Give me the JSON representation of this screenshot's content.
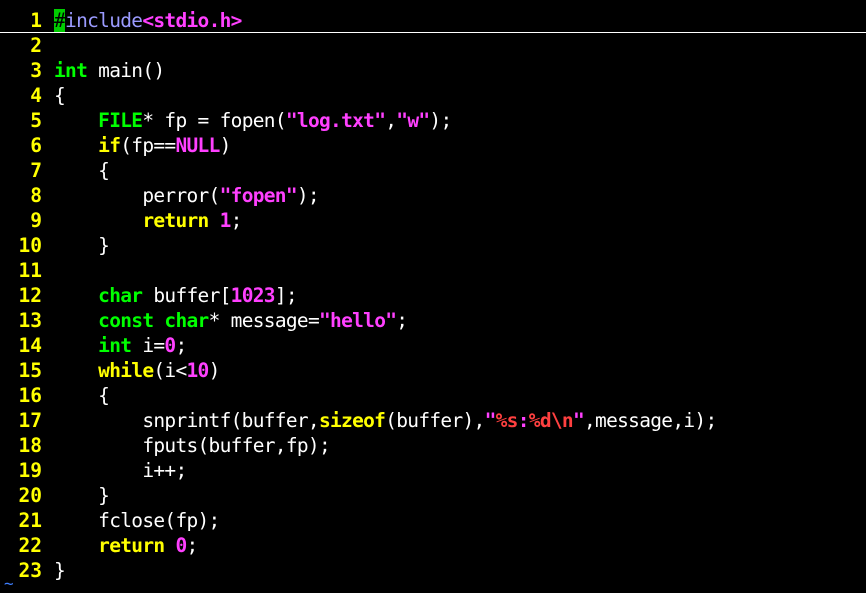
{
  "colors": {
    "background": "#000000",
    "line_number": "#ffff00",
    "keyword": "#ffff00",
    "type": "#00ff00",
    "preproc": "#9b9bff",
    "string": "#ff40ff",
    "number": "#ff40ff",
    "special": "#ff4040",
    "normal": "#ffffff",
    "cursor": "#00cc00",
    "tilde": "#3f7fff"
  },
  "editor": {
    "cursor_line": 1,
    "lines": [
      {
        "n": "1",
        "tokens": [
          {
            "t": "#",
            "c": "cursor"
          },
          {
            "t": "include",
            "c": "preproc"
          },
          {
            "t": "<stdio.h>",
            "c": "string"
          }
        ]
      },
      {
        "n": "2",
        "tokens": []
      },
      {
        "n": "3",
        "tokens": [
          {
            "t": "int",
            "c": "type"
          },
          {
            "t": " main()",
            "c": "normal"
          }
        ]
      },
      {
        "n": "4",
        "tokens": [
          {
            "t": "{",
            "c": "normal"
          }
        ]
      },
      {
        "n": "5",
        "tokens": [
          {
            "t": "    ",
            "c": "normal"
          },
          {
            "t": "FILE",
            "c": "type"
          },
          {
            "t": "* fp = fopen(",
            "c": "normal"
          },
          {
            "t": "\"log.txt\"",
            "c": "string"
          },
          {
            "t": ",",
            "c": "normal"
          },
          {
            "t": "\"w\"",
            "c": "string"
          },
          {
            "t": ");",
            "c": "normal"
          }
        ]
      },
      {
        "n": "6",
        "tokens": [
          {
            "t": "    ",
            "c": "normal"
          },
          {
            "t": "if",
            "c": "keyword"
          },
          {
            "t": "(fp==",
            "c": "normal"
          },
          {
            "t": "NULL",
            "c": "string"
          },
          {
            "t": ")",
            "c": "normal"
          }
        ]
      },
      {
        "n": "7",
        "tokens": [
          {
            "t": "    {",
            "c": "normal"
          }
        ]
      },
      {
        "n": "8",
        "tokens": [
          {
            "t": "        perror(",
            "c": "normal"
          },
          {
            "t": "\"fopen\"",
            "c": "string"
          },
          {
            "t": ");",
            "c": "normal"
          }
        ]
      },
      {
        "n": "9",
        "tokens": [
          {
            "t": "        ",
            "c": "normal"
          },
          {
            "t": "return",
            "c": "keyword"
          },
          {
            "t": " ",
            "c": "normal"
          },
          {
            "t": "1",
            "c": "number"
          },
          {
            "t": ";",
            "c": "normal"
          }
        ]
      },
      {
        "n": "10",
        "tokens": [
          {
            "t": "    }",
            "c": "normal"
          }
        ]
      },
      {
        "n": "11",
        "tokens": []
      },
      {
        "n": "12",
        "tokens": [
          {
            "t": "    ",
            "c": "normal"
          },
          {
            "t": "char",
            "c": "type"
          },
          {
            "t": " buffer[",
            "c": "normal"
          },
          {
            "t": "1023",
            "c": "number"
          },
          {
            "t": "];",
            "c": "normal"
          }
        ]
      },
      {
        "n": "13",
        "tokens": [
          {
            "t": "    ",
            "c": "normal"
          },
          {
            "t": "const",
            "c": "type"
          },
          {
            "t": " ",
            "c": "normal"
          },
          {
            "t": "char",
            "c": "type"
          },
          {
            "t": "* message=",
            "c": "normal"
          },
          {
            "t": "\"hello\"",
            "c": "string"
          },
          {
            "t": ";",
            "c": "normal"
          }
        ]
      },
      {
        "n": "14",
        "tokens": [
          {
            "t": "    ",
            "c": "normal"
          },
          {
            "t": "int",
            "c": "type"
          },
          {
            "t": " i=",
            "c": "normal"
          },
          {
            "t": "0",
            "c": "number"
          },
          {
            "t": ";",
            "c": "normal"
          }
        ]
      },
      {
        "n": "15",
        "tokens": [
          {
            "t": "    ",
            "c": "normal"
          },
          {
            "t": "while",
            "c": "keyword"
          },
          {
            "t": "(i<",
            "c": "normal"
          },
          {
            "t": "10",
            "c": "number"
          },
          {
            "t": ")",
            "c": "normal"
          }
        ]
      },
      {
        "n": "16",
        "tokens": [
          {
            "t": "    {",
            "c": "normal"
          }
        ]
      },
      {
        "n": "17",
        "tokens": [
          {
            "t": "        snprintf(buffer,",
            "c": "normal"
          },
          {
            "t": "sizeof",
            "c": "keyword"
          },
          {
            "t": "(buffer),",
            "c": "normal"
          },
          {
            "t": "\"",
            "c": "string"
          },
          {
            "t": "%s",
            "c": "special"
          },
          {
            "t": ":",
            "c": "string"
          },
          {
            "t": "%d\\n",
            "c": "special"
          },
          {
            "t": "\"",
            "c": "string"
          },
          {
            "t": ",message,i);",
            "c": "normal"
          }
        ]
      },
      {
        "n": "18",
        "tokens": [
          {
            "t": "        fputs(buffer,fp);",
            "c": "normal"
          }
        ]
      },
      {
        "n": "19",
        "tokens": [
          {
            "t": "        i++;",
            "c": "normal"
          }
        ]
      },
      {
        "n": "20",
        "tokens": [
          {
            "t": "    }",
            "c": "normal"
          }
        ]
      },
      {
        "n": "21",
        "tokens": [
          {
            "t": "    fclose(fp);",
            "c": "normal"
          }
        ]
      },
      {
        "n": "22",
        "tokens": [
          {
            "t": "    ",
            "c": "normal"
          },
          {
            "t": "return",
            "c": "keyword"
          },
          {
            "t": " ",
            "c": "normal"
          },
          {
            "t": "0",
            "c": "number"
          },
          {
            "t": ";",
            "c": "normal"
          }
        ]
      },
      {
        "n": "23",
        "tokens": [
          {
            "t": "}",
            "c": "normal"
          }
        ]
      }
    ],
    "end_marker": "~"
  }
}
